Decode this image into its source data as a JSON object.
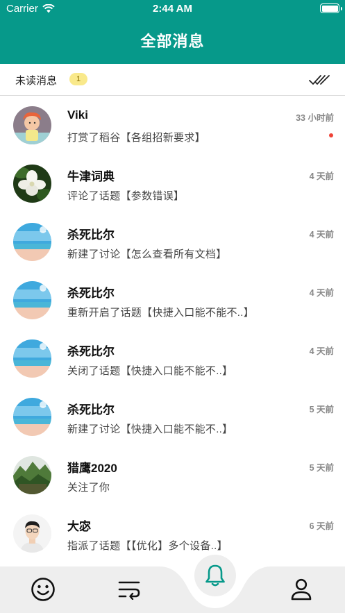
{
  "status_bar": {
    "carrier": "Carrier",
    "time": "2:44 AM"
  },
  "header": {
    "title": "全部消息"
  },
  "unread_bar": {
    "label": "未读消息",
    "count": "1"
  },
  "messages": [
    {
      "name": "Viki",
      "text": "打赏了稻谷【各组招新要求】",
      "time": "33 小时前",
      "unread": true
    },
    {
      "name": "牛津词典",
      "text": "评论了话题【参数错误】",
      "time": "4 天前",
      "unread": false
    },
    {
      "name": "杀死比尔",
      "text": "新建了讨论【怎么查看所有文档】",
      "time": "4 天前",
      "unread": false
    },
    {
      "name": "杀死比尔",
      "text": "重新开启了话题【快捷入口能不能不..】",
      "time": "4 天前",
      "unread": false
    },
    {
      "name": "杀死比尔",
      "text": "关闭了话题【快捷入口能不能不..】",
      "time": "4 天前",
      "unread": false
    },
    {
      "name": "杀死比尔",
      "text": "新建了讨论【快捷入口能不能不..】",
      "time": "5 天前",
      "unread": false
    },
    {
      "name": "猎鹰2020",
      "text": "关注了你",
      "time": "5 天前",
      "unread": false
    },
    {
      "name": "大宓",
      "text": "指派了话题【【优化】多个设备..】",
      "time": "6 天前",
      "unread": false
    }
  ],
  "colors": {
    "brand": "#06998a",
    "badge": "#f9e98b",
    "unread_dot": "#ef4236",
    "tabbar": "#eeeeee"
  },
  "tabbar": {
    "icons": [
      "smile-icon",
      "feed-icon",
      "bell-icon",
      "user-icon"
    ],
    "active": "bell-icon"
  }
}
